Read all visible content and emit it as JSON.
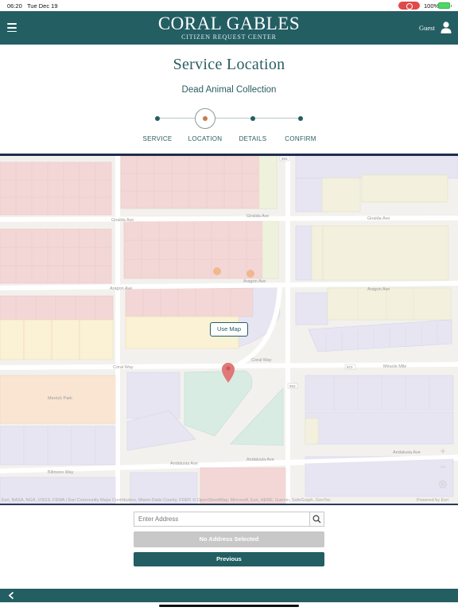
{
  "status_bar": {
    "time": "06:20",
    "date": "Tue Dec 19",
    "battery_percent": "100%",
    "battery_level": 1.0
  },
  "header": {
    "logo_main": "CORAL GABLES",
    "logo_sub": "CITIZEN REQUEST CENTER",
    "user_label": "Guest",
    "icons": [
      "hamburger-menu-icon",
      "user-icon"
    ],
    "bg_color": "#235e63"
  },
  "page": {
    "title": "Service Location",
    "subtitle": "Dead Animal Collection"
  },
  "stepper": {
    "steps": [
      {
        "label": "SERVICE"
      },
      {
        "label": "LOCATION"
      },
      {
        "label": "DETAILS"
      },
      {
        "label": "CONFIRM"
      }
    ],
    "current_step": 2,
    "active_color": "#c87a48"
  },
  "map": {
    "streets": {
      "giralda_left": "Giralda Ave",
      "giralda_right": "Giralda Ave",
      "aragon_left": "Aragon Ave",
      "aragon_mid": "Aragon Ave",
      "aragon_right": "Aragon Ave",
      "coral_left": "Coral Way",
      "coral_mid": "Coral Way",
      "miracle": "Miracle Mile",
      "andalusia_mid": "Andalusia Ave",
      "andalusia_right": "Andalusia Ave",
      "andalusia_far": "Andalusia Ave",
      "biltmore": "Biltmore Way"
    },
    "place_labels": {
      "merrick": "Merrick Park"
    },
    "route_shields": [
      "953",
      "972",
      "953"
    ],
    "use_map_label": "Use Map",
    "attribution": "Esri, NASA, NGA, USGS, FEMA | Esri Community Maps Contributors, Miami-Dade County, FDEP, © OpenStreetMap, Microsoft, Esri, HERE, Garmin, SafeGraph, GeoTec",
    "powered_by": "Powered by Esri",
    "controls": {
      "zoom_in": "+",
      "zoom_out": "−"
    }
  },
  "form": {
    "address_placeholder": "Enter Address",
    "address_value": "",
    "no_address_label": "No Address Selected",
    "previous_label": "Previous"
  },
  "footer": {
    "back_icon": "chevron-left-icon"
  }
}
